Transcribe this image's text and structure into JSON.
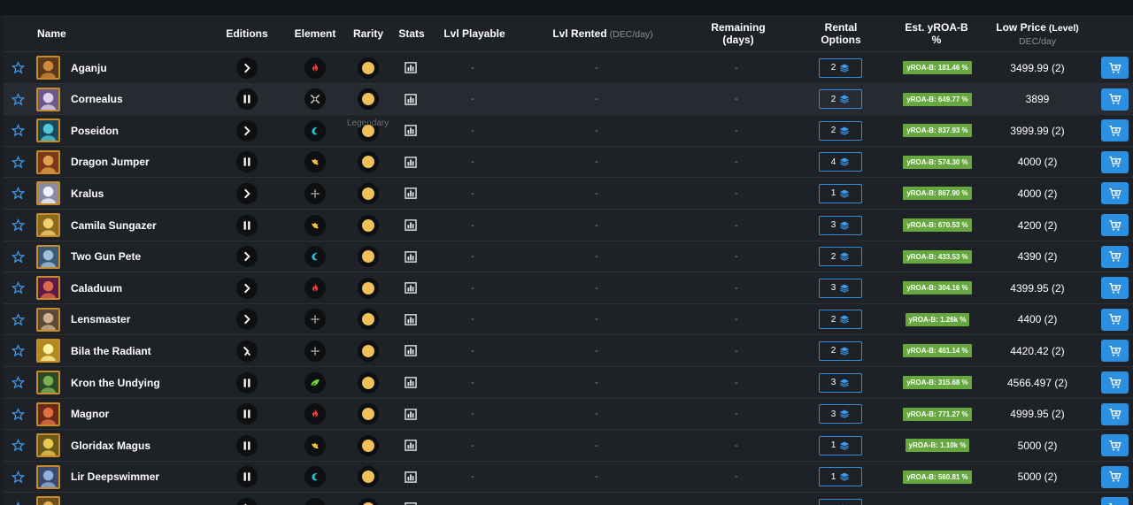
{
  "header": {
    "name": "Name",
    "editions": "Editions",
    "element": "Element",
    "rarity": "Rarity",
    "stats": "Stats",
    "lvl_playable": "Lvl Playable",
    "lvl_rented": "Lvl Rented",
    "lvl_rented_unit": "(DEC/day)",
    "remaining": "Remaining (days)",
    "rental_options": "Rental Options",
    "est_yroa": "Est. yROA-B %",
    "low_price": "Low Price",
    "low_price_level": "(Level)",
    "low_price_unit": "DEC/day"
  },
  "tooltip": "Legendary",
  "colors": {
    "background": "#1e2126",
    "accent_blue": "#2d8fe0",
    "yroa_green": "#66a83f",
    "rarity_gold": "#f0c15a",
    "fire": "#e8473c",
    "water": "#1fc8e6",
    "earth": "#6cd43a",
    "life": "#ffffff",
    "death": "#b8b8b8",
    "dragon": "#f2c23a"
  },
  "rows": [
    {
      "name": "Aganju",
      "edition": "chevron-icon",
      "element": "fire-icon",
      "stats": "-",
      "lvl_playable": "-",
      "lvl_rented": "-",
      "remaining": "-",
      "rental_options": "2",
      "yroa": "yROA-B: 181.46 %",
      "price": "3499.99 (2)"
    },
    {
      "name": "Cornealus",
      "edition": "pause-icon",
      "element": "death-icon",
      "stats": "-",
      "lvl_playable": "-",
      "lvl_rented": "-",
      "remaining": "-",
      "rental_options": "2",
      "yroa": "yROA-B: 649.77 %",
      "price": "3899"
    },
    {
      "name": "Poseidon",
      "edition": "chevron-icon",
      "element": "water-icon",
      "stats": "-",
      "lvl_playable": "-",
      "lvl_rented": "-",
      "remaining": "-",
      "rental_options": "2",
      "yroa": "yROA-B: 837.93 %",
      "price": "3999.99 (2)"
    },
    {
      "name": "Dragon Jumper",
      "edition": "pause-icon",
      "element": "dragon-icon",
      "stats": "-",
      "lvl_playable": "-",
      "lvl_rented": "-",
      "remaining": "-",
      "rental_options": "4",
      "yroa": "yROA-B: 574.30 %",
      "price": "4000 (2)"
    },
    {
      "name": "Kralus",
      "edition": "chevron-icon",
      "element": "life-icon",
      "stats": "-",
      "lvl_playable": "-",
      "lvl_rented": "-",
      "remaining": "-",
      "rental_options": "1",
      "yroa": "yROA-B: 867.90 %",
      "price": "4000 (2)"
    },
    {
      "name": "Camila Sungazer",
      "edition": "pause-icon",
      "element": "dragon-icon",
      "stats": "-",
      "lvl_playable": "-",
      "lvl_rented": "-",
      "remaining": "-",
      "rental_options": "3",
      "yroa": "yROA-B: 670.53 %",
      "price": "4200 (2)"
    },
    {
      "name": "Two Gun Pete",
      "edition": "chevron-icon",
      "element": "water-icon",
      "stats": "-",
      "lvl_playable": "-",
      "lvl_rented": "-",
      "remaining": "-",
      "rental_options": "2",
      "yroa": "yROA-B: 433.53 %",
      "price": "4390 (2)"
    },
    {
      "name": "Caladuum",
      "edition": "chevron-icon",
      "element": "fire-icon",
      "stats": "-",
      "lvl_playable": "-",
      "lvl_rented": "-",
      "remaining": "-",
      "rental_options": "3",
      "yroa": "yROA-B: 304.16 %",
      "price": "4399.95 (2)"
    },
    {
      "name": "Lensmaster",
      "edition": "chevron-icon",
      "element": "life-icon",
      "stats": "-",
      "lvl_playable": "-",
      "lvl_rented": "-",
      "remaining": "-",
      "rental_options": "2",
      "yroa": "yROA-B: 1.26k %",
      "price": "4400 (2)"
    },
    {
      "name": "Bila the Radiant",
      "edition": "rebellion-icon",
      "element": "life-icon",
      "stats": "-",
      "lvl_playable": "-",
      "lvl_rented": "-",
      "remaining": "-",
      "rental_options": "2",
      "yroa": "yROA-B: 461.14 %",
      "price": "4420.42 (2)"
    },
    {
      "name": "Kron the Undying",
      "edition": "pause-icon",
      "element": "earth-icon",
      "stats": "-",
      "lvl_playable": "-",
      "lvl_rented": "-",
      "remaining": "-",
      "rental_options": "3",
      "yroa": "yROA-B: 315.68 %",
      "price": "4566.497 (2)"
    },
    {
      "name": "Magnor",
      "edition": "pause-icon",
      "element": "fire-icon",
      "stats": "-",
      "lvl_playable": "-",
      "lvl_rented": "-",
      "remaining": "-",
      "rental_options": "3",
      "yroa": "yROA-B: 771.27 %",
      "price": "4999.95 (2)"
    },
    {
      "name": "Gloridax Magus",
      "edition": "pause-icon",
      "element": "dragon-icon",
      "stats": "-",
      "lvl_playable": "-",
      "lvl_rented": "-",
      "remaining": "-",
      "rental_options": "1",
      "yroa": "yROA-B: 1.10k %",
      "price": "5000 (2)"
    },
    {
      "name": "Lir Deepswimmer",
      "edition": "pause-icon",
      "element": "water-icon",
      "stats": "-",
      "lvl_playable": "-",
      "lvl_rented": "-",
      "remaining": "-",
      "rental_options": "1",
      "yroa": "yROA-B: 560.81 %",
      "price": "5000 (2)"
    },
    {
      "name": "",
      "edition": "chevron-icon",
      "element": "dragon-icon",
      "stats": "",
      "lvl_playable": "",
      "lvl_rented": "",
      "remaining": "",
      "rental_options": "",
      "yroa": "",
      "price": ""
    }
  ]
}
